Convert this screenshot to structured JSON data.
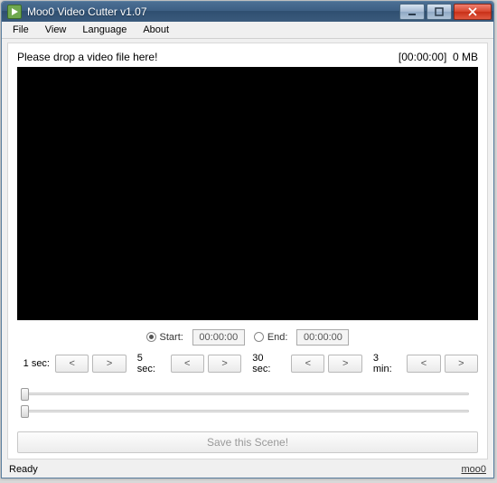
{
  "window": {
    "title": "Moo0 Video Cutter v1.07"
  },
  "menu": {
    "file": "File",
    "view": "View",
    "language": "Language",
    "about": "About"
  },
  "top": {
    "prompt": "Please drop a video file here!",
    "timecode": "[00:00:00]",
    "size": "0 MB"
  },
  "range": {
    "start_label": "Start:",
    "start_value": "00:00:00",
    "end_label": "End:",
    "end_value": "00:00:00",
    "selected": "start"
  },
  "seek": {
    "label_1sec": "1 sec:",
    "label_5sec": "5 sec:",
    "label_30sec": "30 sec:",
    "label_3min": "3 min:",
    "back": "<",
    "fwd": ">"
  },
  "actions": {
    "save": "Save this Scene!"
  },
  "status": {
    "left": "Ready",
    "right": "moo0"
  }
}
